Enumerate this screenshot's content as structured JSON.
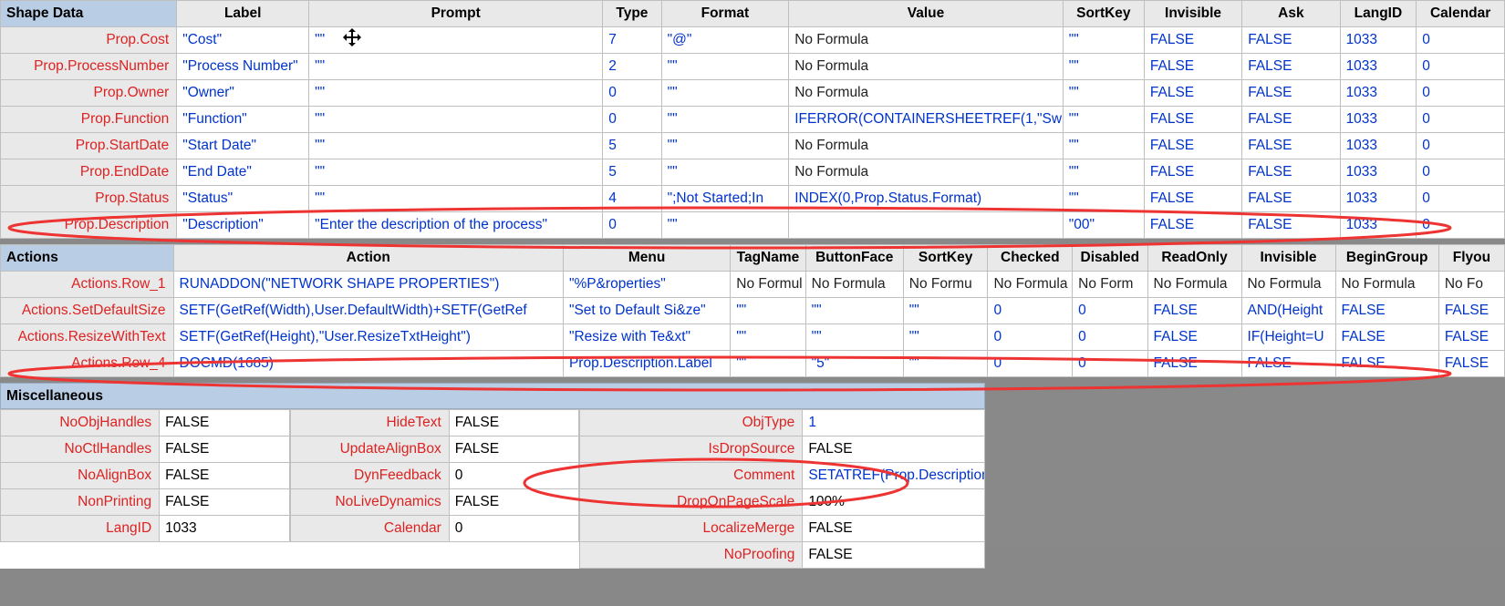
{
  "sections": {
    "shapeData": {
      "title": "Shape Data"
    },
    "actions": {
      "title": "Actions"
    },
    "misc": {
      "title": "Miscellaneous"
    }
  },
  "shapeDataHeaders": [
    "Label",
    "Prompt",
    "Type",
    "Format",
    "Value",
    "SortKey",
    "Invisible",
    "Ask",
    "LangID",
    "Calendar"
  ],
  "shapeDataRows": [
    {
      "name": "Prop.Cost",
      "label": "\"Cost\"",
      "prompt": "\"\"",
      "type": "7",
      "format": "\"@\"",
      "value": "No Formula",
      "sortkey": "\"\"",
      "invisible": "FALSE",
      "ask": "FALSE",
      "langid": "1033",
      "calendar": "0"
    },
    {
      "name": "Prop.ProcessNumber",
      "label": "\"Process Number\"",
      "prompt": "\"\"",
      "type": "2",
      "format": "\"\"",
      "value": "No Formula",
      "sortkey": "\"\"",
      "invisible": "FALSE",
      "ask": "FALSE",
      "langid": "1033",
      "calendar": "0"
    },
    {
      "name": "Prop.Owner",
      "label": "\"Owner\"",
      "prompt": "\"\"",
      "type": "0",
      "format": "\"\"",
      "value": "No Formula",
      "sortkey": "\"\"",
      "invisible": "FALSE",
      "ask": "FALSE",
      "langid": "1033",
      "calendar": "0"
    },
    {
      "name": "Prop.Function",
      "label": "\"Function\"",
      "prompt": "\"\"",
      "type": "0",
      "format": "\"\"",
      "value": "IFERROR(CONTAINERSHEETREF(1,\"Sw",
      "sortkey": "\"\"",
      "invisible": "FALSE",
      "ask": "FALSE",
      "langid": "1033",
      "calendar": "0"
    },
    {
      "name": "Prop.StartDate",
      "label": "\"Start Date\"",
      "prompt": "\"\"",
      "type": "5",
      "format": "\"\"",
      "value": "No Formula",
      "sortkey": "\"\"",
      "invisible": "FALSE",
      "ask": "FALSE",
      "langid": "1033",
      "calendar": "0"
    },
    {
      "name": "Prop.EndDate",
      "label": "\"End Date\"",
      "prompt": "\"\"",
      "type": "5",
      "format": "\"\"",
      "value": "No Formula",
      "sortkey": "\"\"",
      "invisible": "FALSE",
      "ask": "FALSE",
      "langid": "1033",
      "calendar": "0"
    },
    {
      "name": "Prop.Status",
      "label": "\"Status\"",
      "prompt": "\"\"",
      "type": "4",
      "format": "\";Not Started;In",
      "value": "INDEX(0,Prop.Status.Format)",
      "sortkey": "\"\"",
      "invisible": "FALSE",
      "ask": "FALSE",
      "langid": "1033",
      "calendar": "0"
    },
    {
      "name": "Prop.Description",
      "label": "\"Description\"",
      "prompt": "\"Enter the description of the process\"",
      "type": "0",
      "format": "\"\"",
      "value": "",
      "sortkey": "\"00\"",
      "invisible": "FALSE",
      "ask": "FALSE",
      "langid": "1033",
      "calendar": "0"
    }
  ],
  "actionsHeaders": [
    "Action",
    "Menu",
    "TagName",
    "ButtonFace",
    "SortKey",
    "Checked",
    "Disabled",
    "ReadOnly",
    "Invisible",
    "BeginGroup",
    "Flyou"
  ],
  "actionsRows": [
    {
      "name": "Actions.Row_1",
      "action": "RUNADDON(\"NETWORK SHAPE PROPERTIES\")",
      "menu": "\"%P&roperties\"",
      "tag": "No Formul",
      "face": "No Formula",
      "sortkey": "No Formu",
      "checked": "No Formula",
      "disabled": "No Form",
      "readonly": "No Formula",
      "invisible": "No Formula",
      "begingroup": "No Formula",
      "flyout": "No Fo"
    },
    {
      "name": "Actions.SetDefaultSize",
      "action": "SETF(GetRef(Width),User.DefaultWidth)+SETF(GetRef",
      "menu": "\"Set to Default Si&ze\"",
      "tag": "\"\"",
      "face": "\"\"",
      "sortkey": "\"\"",
      "checked": "0",
      "disabled": "0",
      "readonly": "FALSE",
      "invisible": "AND(Height",
      "begingroup": "FALSE",
      "flyout": "FALSE"
    },
    {
      "name": "Actions.ResizeWithText",
      "action": "SETF(GetRef(Height),\"User.ResizeTxtHeight\")",
      "menu": "\"Resize with Te&xt\"",
      "tag": "\"\"",
      "face": "\"\"",
      "sortkey": "\"\"",
      "checked": "0",
      "disabled": "0",
      "readonly": "FALSE",
      "invisible": "IF(Height=U",
      "begingroup": "FALSE",
      "flyout": "FALSE"
    },
    {
      "name": "Actions.Row_4",
      "action": "DOCMD(1685)",
      "menu": "Prop.Description.Label",
      "tag": "\"\"",
      "face": "\"5\"",
      "sortkey": "\"\"",
      "checked": "0",
      "disabled": "0",
      "readonly": "FALSE",
      "invisible": "FALSE",
      "begingroup": "FALSE",
      "flyout": "FALSE"
    }
  ],
  "misc": {
    "col1": [
      [
        "NoObjHandles",
        "FALSE"
      ],
      [
        "NoCtlHandles",
        "FALSE"
      ],
      [
        "NoAlignBox",
        "FALSE"
      ],
      [
        "NonPrinting",
        "FALSE"
      ],
      [
        "LangID",
        "1033"
      ]
    ],
    "col2": [
      [
        "HideText",
        "FALSE"
      ],
      [
        "UpdateAlignBox",
        "FALSE"
      ],
      [
        "DynFeedback",
        "0"
      ],
      [
        "NoLiveDynamics",
        "FALSE"
      ],
      [
        "Calendar",
        "0"
      ]
    ],
    "col3": [
      [
        "ObjType",
        "1",
        "blue"
      ],
      [
        "IsDropSource",
        "FALSE",
        ""
      ],
      [
        "Comment",
        "SETATREF(Prop.Description)",
        "blue"
      ],
      [
        "DropOnPageScale",
        "100%",
        ""
      ],
      [
        "LocalizeMerge",
        "FALSE",
        ""
      ],
      [
        "NoProofing",
        "FALSE",
        ""
      ]
    ]
  }
}
